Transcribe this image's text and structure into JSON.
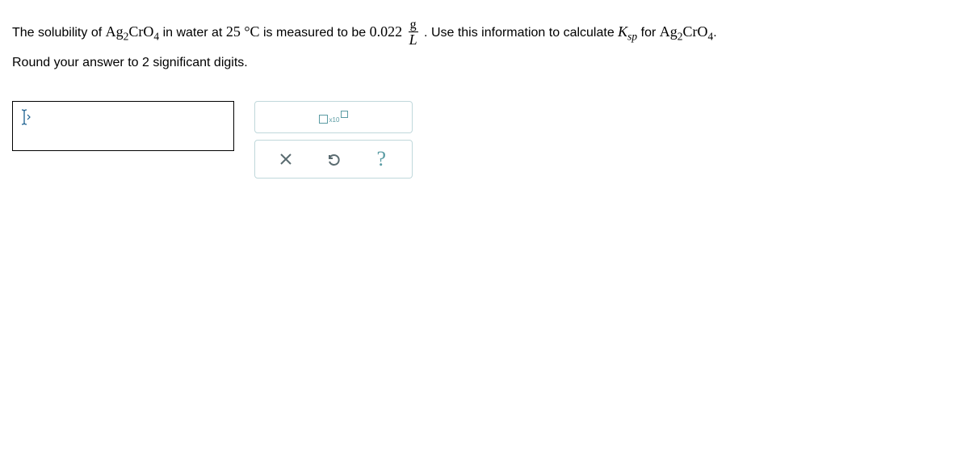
{
  "question": {
    "part1": "The solubility of ",
    "compound": "Ag",
    "sub2": "2",
    "compound2": "CrO",
    "sub4": "4",
    "part2": " in water at ",
    "temp": "25 °C",
    "part3": " is measured to be ",
    "value": "0.022",
    "unit_num": "g",
    "unit_den": "L",
    "part4": ". Use this information to calculate ",
    "ksp_k": "K",
    "ksp_sub": "sp",
    "part5": " for ",
    "compound3": "Ag",
    "compound4": "CrO",
    "part6": ".",
    "round_text": "Round your answer to 2 significant digits."
  },
  "tools": {
    "sci_x10": "x10",
    "help": "?"
  }
}
